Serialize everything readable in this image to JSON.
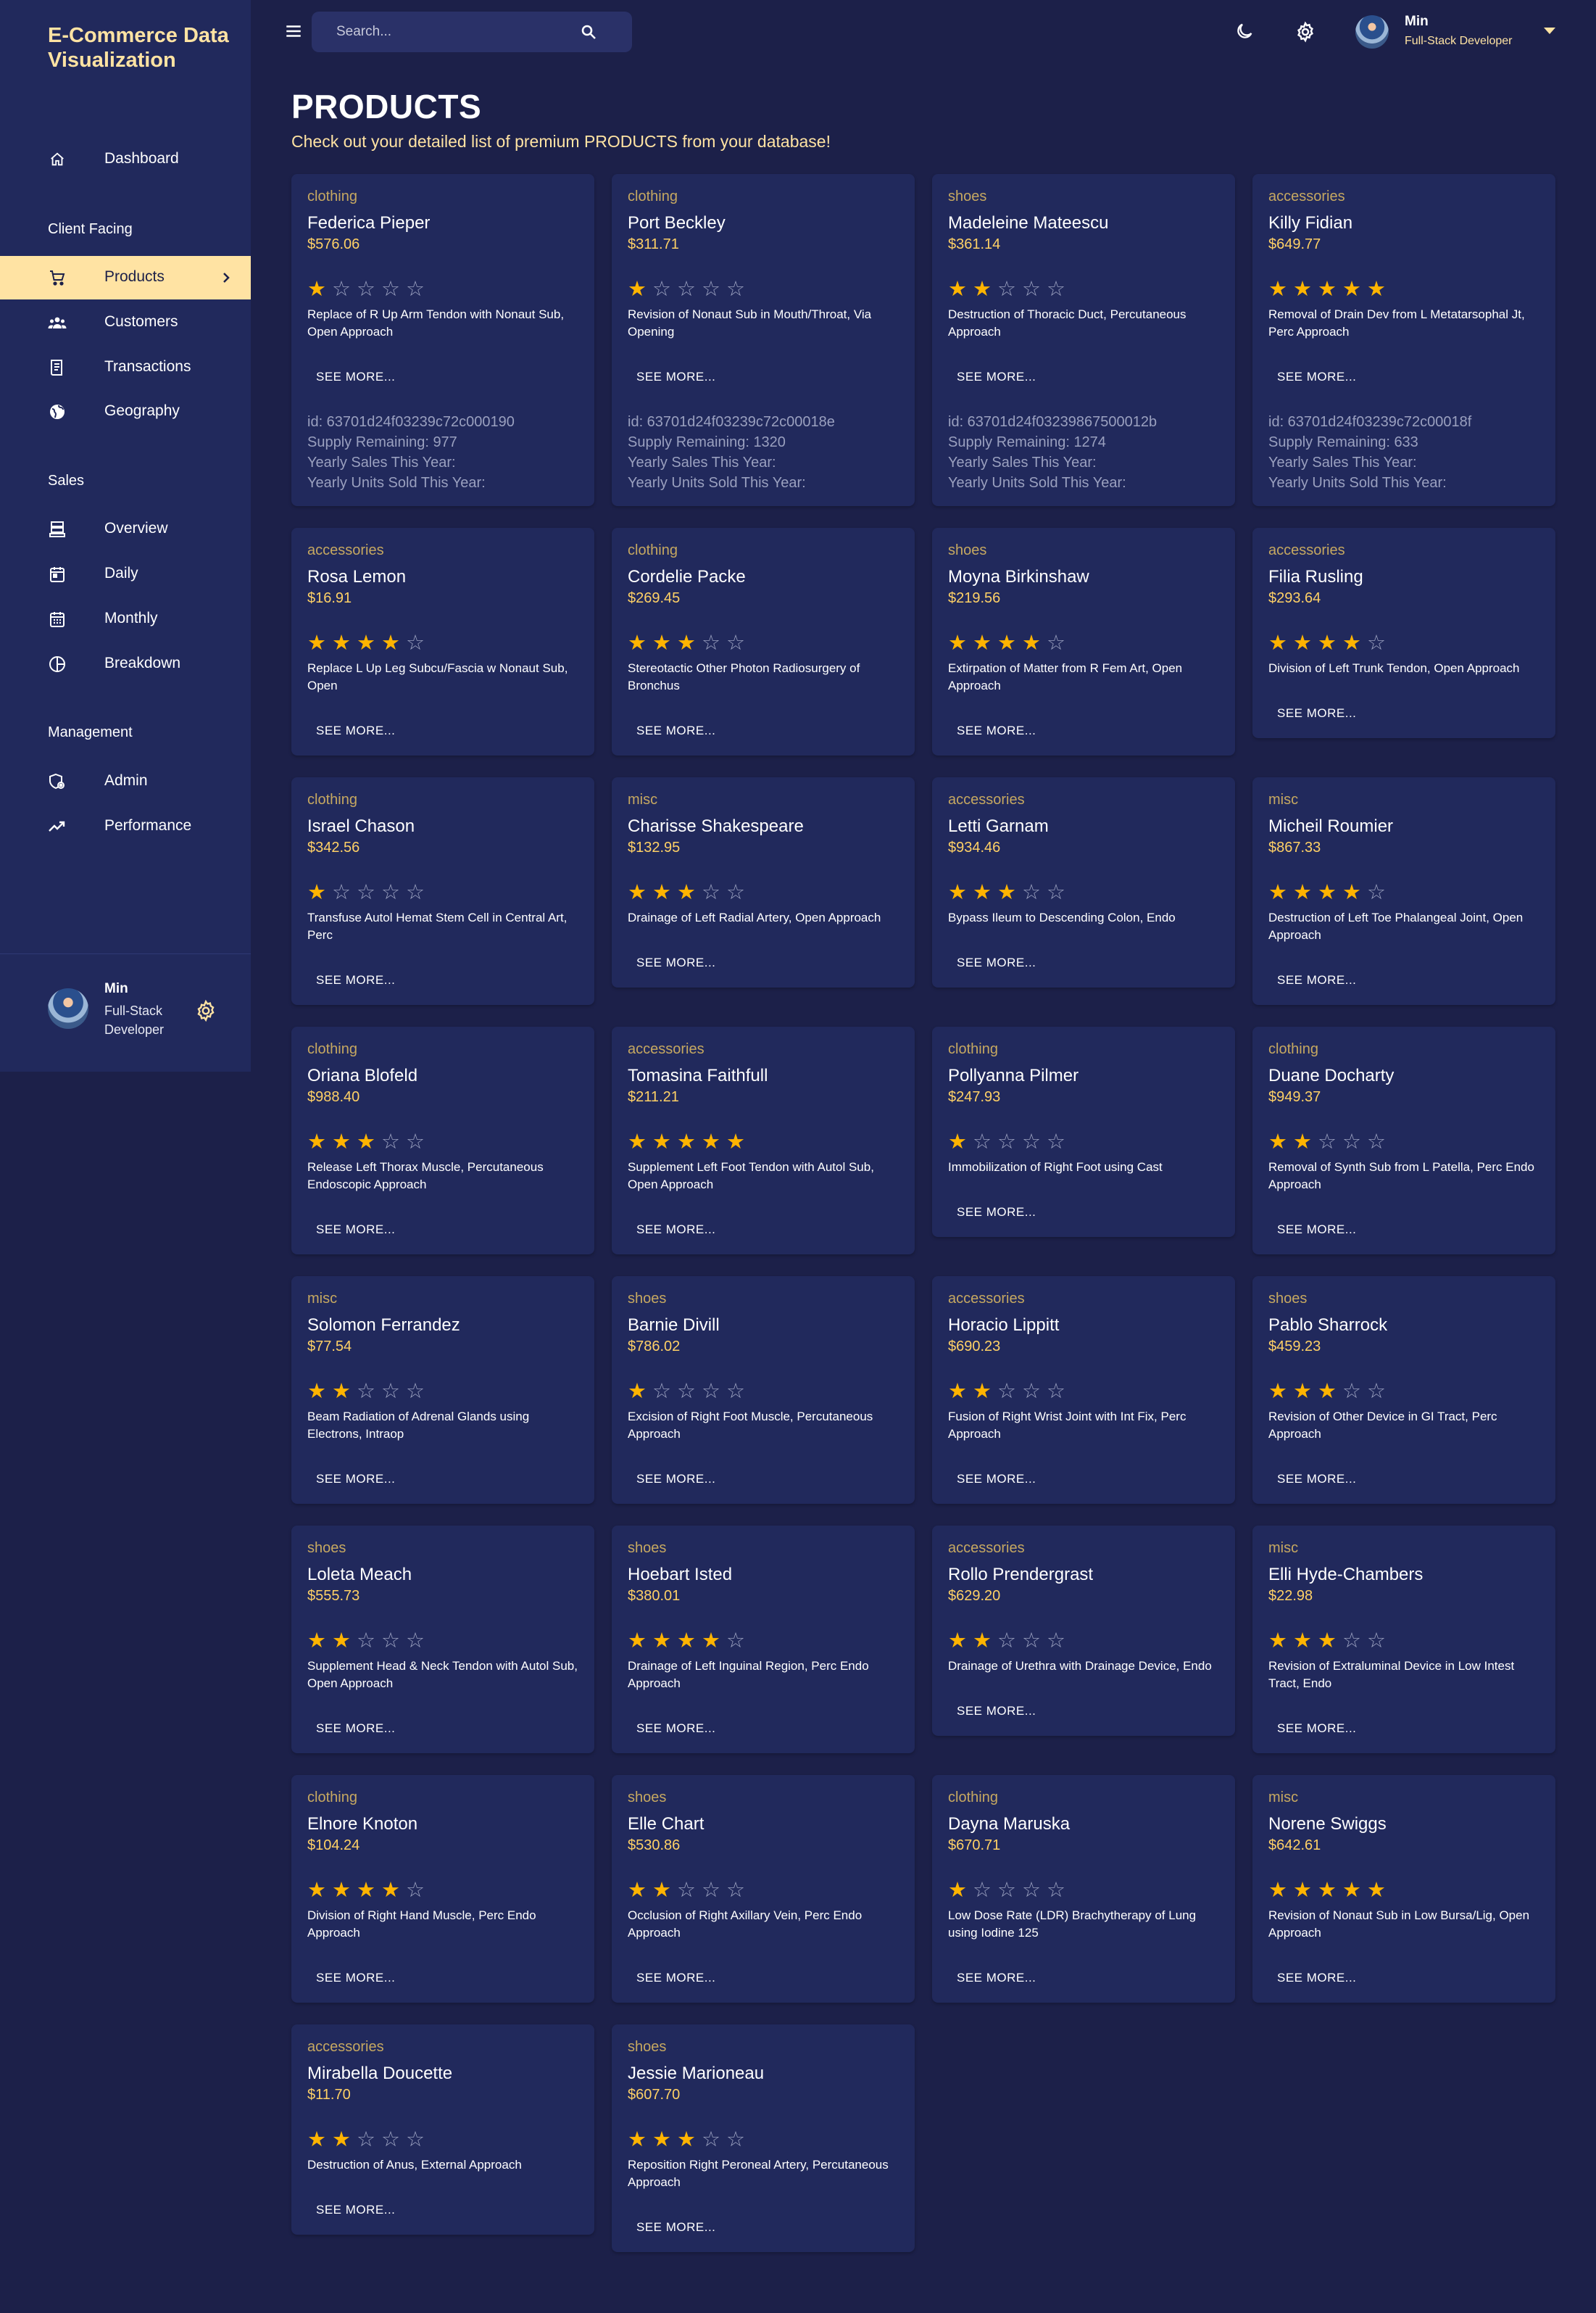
{
  "app": {
    "title": "E-Commerce Data Visualization"
  },
  "topbar": {
    "search_placeholder": "Search...",
    "user_name": "Min",
    "user_role": "Full-Stack Developer"
  },
  "sidebar": {
    "dashboard": "Dashboard",
    "sections": {
      "client": "Client Facing",
      "sales": "Sales",
      "management": "Management"
    },
    "items": {
      "products": "Products",
      "customers": "Customers",
      "transactions": "Transactions",
      "geography": "Geography",
      "overview": "Overview",
      "daily": "Daily",
      "monthly": "Monthly",
      "breakdown": "Breakdown",
      "admin": "Admin",
      "performance": "Performance"
    },
    "user": {
      "name": "Min",
      "role": "Full-Stack Developer"
    }
  },
  "header": {
    "title": "PRODUCTS",
    "subtitle": "Check out your detailed list of premium PRODUCTS from your database!"
  },
  "see_more_label": "SEE MORE...",
  "extra_labels": {
    "supply": "Supply Remaining:",
    "yearly_sales": "Yearly Sales This Year:",
    "yearly_units": "Yearly Units Sold This Year:"
  },
  "products": [
    {
      "category": "clothing",
      "name": "Federica Pieper",
      "price": "$576.06",
      "rating": 1,
      "description": "Replace of R Up Arm Tendon with Nonaut Sub, Open Approach",
      "expanded": true,
      "id_text": "id: 63701d24f03239c72c000190",
      "supply": "977"
    },
    {
      "category": "clothing",
      "name": "Port Beckley",
      "price": "$311.71",
      "rating": 1,
      "description": "Revision of Nonaut Sub in Mouth/Throat, Via Opening",
      "expanded": true,
      "id_text": "id: 63701d24f03239c72c00018e",
      "supply": "1320"
    },
    {
      "category": "shoes",
      "name": "Madeleine Mateescu",
      "price": "$361.14",
      "rating": 2,
      "description": "Destruction of Thoracic Duct, Percutaneous Approach",
      "expanded": true,
      "id_text": "id: 63701d24f03239867500012b",
      "supply": "1274"
    },
    {
      "category": "accessories",
      "name": "Killy Fidian",
      "price": "$649.77",
      "rating": 5,
      "description": "Removal of Drain Dev from L Metatarsophal Jt, Perc Approach",
      "expanded": true,
      "id_text": "id: 63701d24f03239c72c00018f",
      "supply": "633"
    },
    {
      "category": "accessories",
      "name": "Rosa Lemon",
      "price": "$16.91",
      "rating": 4,
      "description": "Replace L Up Leg Subcu/Fascia w Nonaut Sub, Open"
    },
    {
      "category": "clothing",
      "name": "Cordelie Packe",
      "price": "$269.45",
      "rating": 3,
      "description": "Stereotactic Other Photon Radiosurgery of Bronchus"
    },
    {
      "category": "shoes",
      "name": "Moyna Birkinshaw",
      "price": "$219.56",
      "rating": 4,
      "description": "Extirpation of Matter from R Fem Art, Open Approach"
    },
    {
      "category": "accessories",
      "name": "Filia Rusling",
      "price": "$293.64",
      "rating": 4,
      "description": "Division of Left Trunk Tendon, Open Approach"
    },
    {
      "category": "clothing",
      "name": "Israel Chason",
      "price": "$342.56",
      "rating": 1,
      "description": "Transfuse Autol Hemat Stem Cell in Central Art, Perc"
    },
    {
      "category": "misc",
      "name": "Charisse Shakespeare",
      "price": "$132.95",
      "rating": 3,
      "description": "Drainage of Left Radial Artery, Open Approach"
    },
    {
      "category": "accessories",
      "name": "Letti Garnam",
      "price": "$934.46",
      "rating": 3,
      "description": "Bypass Ileum to Descending Colon, Endo"
    },
    {
      "category": "misc",
      "name": "Micheil Roumier",
      "price": "$867.33",
      "rating": 4,
      "description": "Destruction of Left Toe Phalangeal Joint, Open Approach"
    },
    {
      "category": "clothing",
      "name": "Oriana Blofeld",
      "price": "$988.40",
      "rating": 3,
      "description": "Release Left Thorax Muscle, Percutaneous Endoscopic Approach"
    },
    {
      "category": "accessories",
      "name": "Tomasina Faithfull",
      "price": "$211.21",
      "rating": 5,
      "description": "Supplement Left Foot Tendon with Autol Sub, Open Approach"
    },
    {
      "category": "clothing",
      "name": "Pollyanna Pilmer",
      "price": "$247.93",
      "rating": 1,
      "description": "Immobilization of Right Foot using Cast"
    },
    {
      "category": "clothing",
      "name": "Duane Docharty",
      "price": "$949.37",
      "rating": 2,
      "description": "Removal of Synth Sub from L Patella, Perc Endo Approach"
    },
    {
      "category": "misc",
      "name": "Solomon Ferrandez",
      "price": "$77.54",
      "rating": 2,
      "description": "Beam Radiation of Adrenal Glands using Electrons, Intraop"
    },
    {
      "category": "shoes",
      "name": "Barnie Divill",
      "price": "$786.02",
      "rating": 1,
      "description": "Excision of Right Foot Muscle, Percutaneous Approach"
    },
    {
      "category": "accessories",
      "name": "Horacio Lippitt",
      "price": "$690.23",
      "rating": 2,
      "description": "Fusion of Right Wrist Joint with Int Fix, Perc Approach"
    },
    {
      "category": "shoes",
      "name": "Pablo Sharrock",
      "price": "$459.23",
      "rating": 3,
      "description": "Revision of Other Device in GI Tract, Perc Approach"
    },
    {
      "category": "shoes",
      "name": "Loleta Meach",
      "price": "$555.73",
      "rating": 2,
      "description": "Supplement Head & Neck Tendon with Autol Sub, Open Approach"
    },
    {
      "category": "shoes",
      "name": "Hoebart Isted",
      "price": "$380.01",
      "rating": 4,
      "description": "Drainage of Left Inguinal Region, Perc Endo Approach"
    },
    {
      "category": "accessories",
      "name": "Rollo Prendergrast",
      "price": "$629.20",
      "rating": 2,
      "description": "Drainage of Urethra with Drainage Device, Endo"
    },
    {
      "category": "misc",
      "name": "Elli Hyde-Chambers",
      "price": "$22.98",
      "rating": 3,
      "description": "Revision of Extraluminal Device in Low Intest Tract, Endo"
    },
    {
      "category": "clothing",
      "name": "Elnore Knoton",
      "price": "$104.24",
      "rating": 4,
      "description": "Division of Right Hand Muscle, Perc Endo Approach"
    },
    {
      "category": "shoes",
      "name": "Elle Chart",
      "price": "$530.86",
      "rating": 2,
      "description": "Occlusion of Right Axillary Vein, Perc Endo Approach"
    },
    {
      "category": "clothing",
      "name": "Dayna Maruska",
      "price": "$670.71",
      "rating": 1,
      "description": "Low Dose Rate (LDR) Brachytherapy of Lung using Iodine 125"
    },
    {
      "category": "misc",
      "name": "Norene Swiggs",
      "price": "$642.61",
      "rating": 5,
      "description": "Revision of Nonaut Sub in Low Bursa/Lig, Open Approach"
    },
    {
      "category": "accessories",
      "name": "Mirabella Doucette",
      "price": "$11.70",
      "rating": 2,
      "description": "Destruction of Anus, External Approach"
    },
    {
      "category": "shoes",
      "name": "Jessie Marioneau",
      "price": "$607.70",
      "rating": 3,
      "description": "Reposition Right Peroneal Artery, Percutaneous Approach"
    }
  ],
  "colors": {
    "background": "#1c2049",
    "panel": "#21295c",
    "accent": "#ffe3a3",
    "price": "#ffd166",
    "star": "#ffb400"
  },
  "icons": {
    "menu": "menu-icon",
    "search": "search-icon",
    "theme": "moon-icon",
    "settings": "gear-icon"
  }
}
